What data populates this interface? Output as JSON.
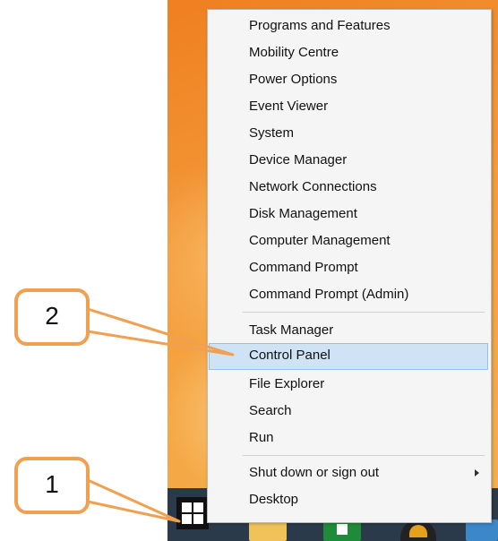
{
  "menu": {
    "group1": [
      {
        "label": "Programs and Features"
      },
      {
        "label": "Mobility Centre"
      },
      {
        "label": "Power Options"
      },
      {
        "label": "Event Viewer"
      },
      {
        "label": "System"
      },
      {
        "label": "Device Manager"
      },
      {
        "label": "Network Connections"
      },
      {
        "label": "Disk Management"
      },
      {
        "label": "Computer Management"
      },
      {
        "label": "Command Prompt"
      },
      {
        "label": "Command Prompt (Admin)"
      }
    ],
    "group2": [
      {
        "label": "Task Manager"
      },
      {
        "label": "Control Panel",
        "highlighted": true
      },
      {
        "label": "File Explorer"
      },
      {
        "label": "Search"
      },
      {
        "label": "Run"
      }
    ],
    "group3": [
      {
        "label": "Shut down or sign out",
        "has_submenu": true
      },
      {
        "label": "Desktop"
      }
    ]
  },
  "annotations": {
    "callout_1": "1",
    "callout_2": "2",
    "color": "#f0a050"
  },
  "taskbar": {
    "icons": [
      "windows-start-icon",
      "file-explorer-icon",
      "store-icon",
      "internet-explorer-icon",
      "app-icon"
    ]
  },
  "colors": {
    "highlight": "#cfe3f6",
    "desktop": "#f29535",
    "taskbar": "#2b3a4a"
  }
}
